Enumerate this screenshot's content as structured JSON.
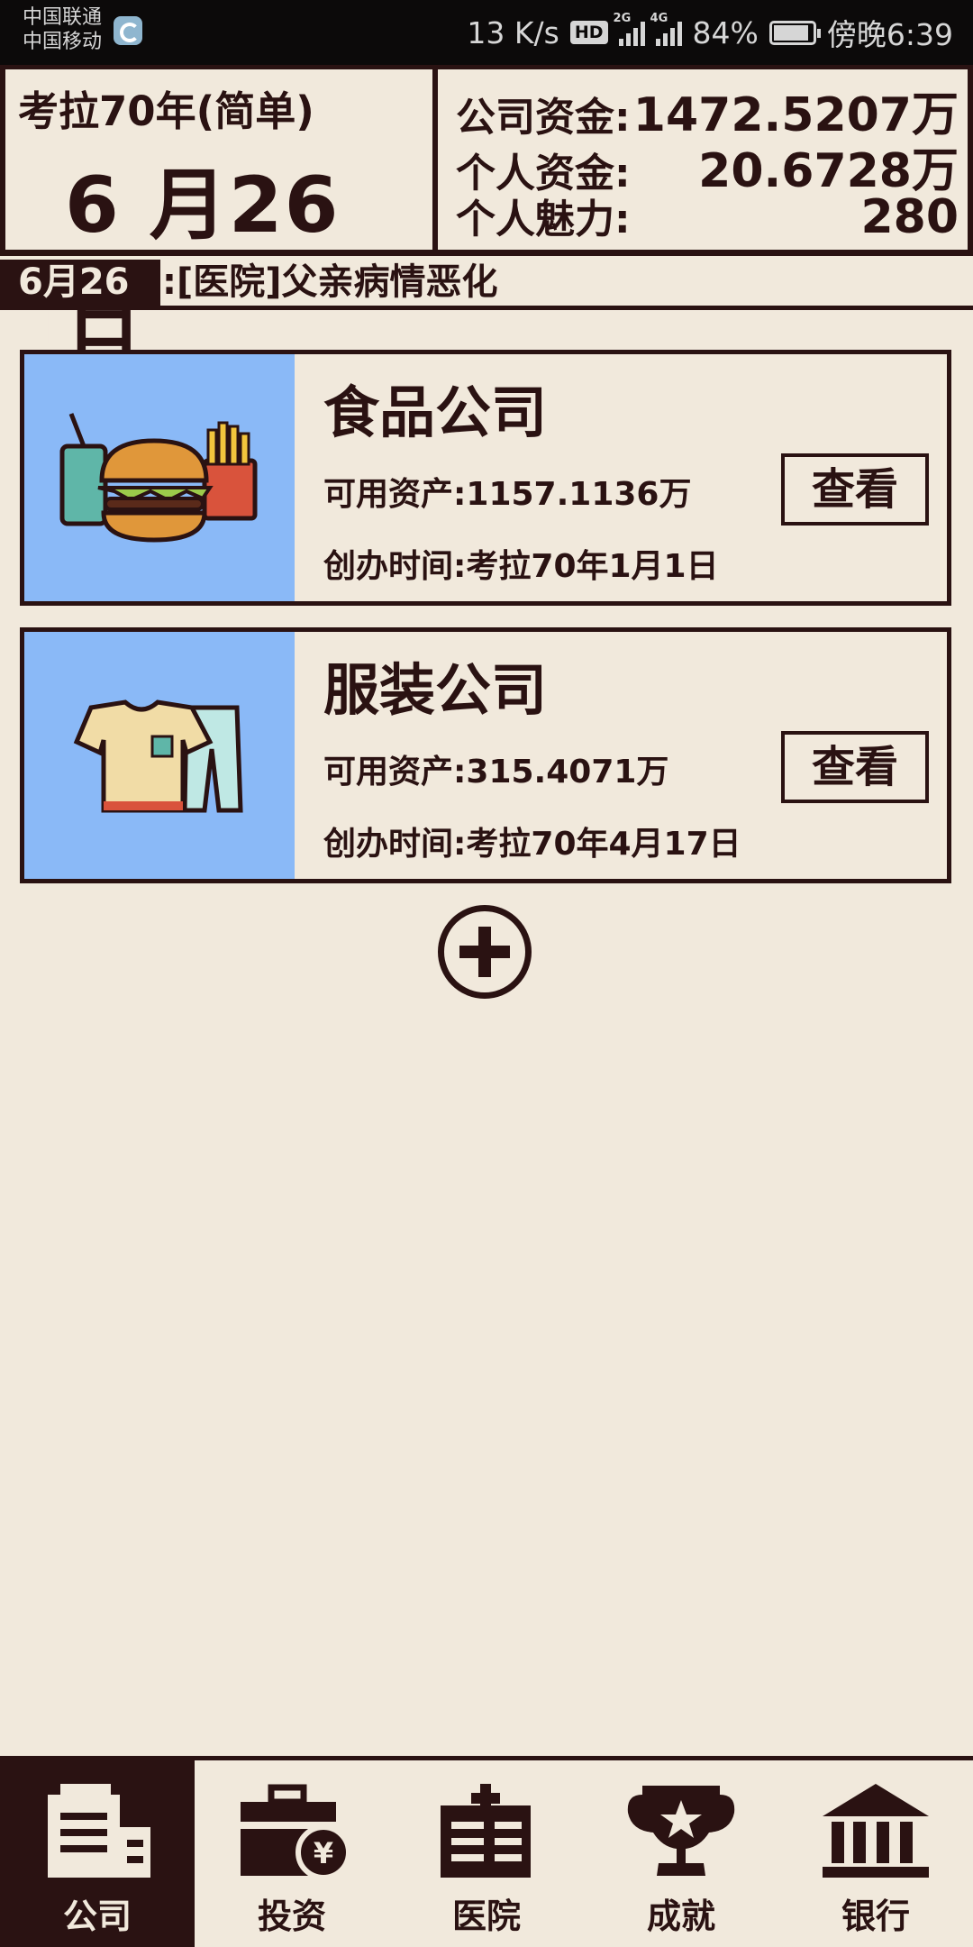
{
  "status_bar": {
    "carrier_1": "中国联通",
    "carrier_2": "中国移动",
    "net_speed": "13 K/s",
    "hd": "HD",
    "net_2g": "2G",
    "net_4g": "4G",
    "battery": "84%",
    "time": "傍晚6:39"
  },
  "header": {
    "game_mode": "考拉70年(简单)",
    "current_date": "6 月26 日",
    "company_funds_label": "公司资金:",
    "company_funds_value": "1472.5207万",
    "personal_funds_label": "个人资金:",
    "personal_funds_value": "20.6728万",
    "charisma_label": "个人魅力:",
    "charisma_value": "280"
  },
  "news": {
    "date": "6月26日",
    "text": ":[医院]父亲病情恶化"
  },
  "companies": [
    {
      "name": "食品公司",
      "assets": "可用资产:1157.1136万",
      "founded": "创办时间:考拉70年1月1日",
      "button": "查看",
      "icon": "fast-food-icon"
    },
    {
      "name": "服装公司",
      "assets": "可用资产:315.4071万",
      "founded": "创办时间:考拉70年4月17日",
      "button": "查看",
      "icon": "clothing-icon"
    }
  ],
  "nav": [
    {
      "label": "公司",
      "icon": "company-building-icon",
      "active": true
    },
    {
      "label": "投资",
      "icon": "investment-briefcase-icon",
      "active": false
    },
    {
      "label": "医院",
      "icon": "hospital-icon",
      "active": false
    },
    {
      "label": "成就",
      "icon": "trophy-icon",
      "active": false
    },
    {
      "label": "银行",
      "icon": "bank-icon",
      "active": false
    }
  ],
  "colors": {
    "background": "#f1e9dc",
    "dark": "#2a1212",
    "card_image_bg": "#8ab9f7"
  }
}
